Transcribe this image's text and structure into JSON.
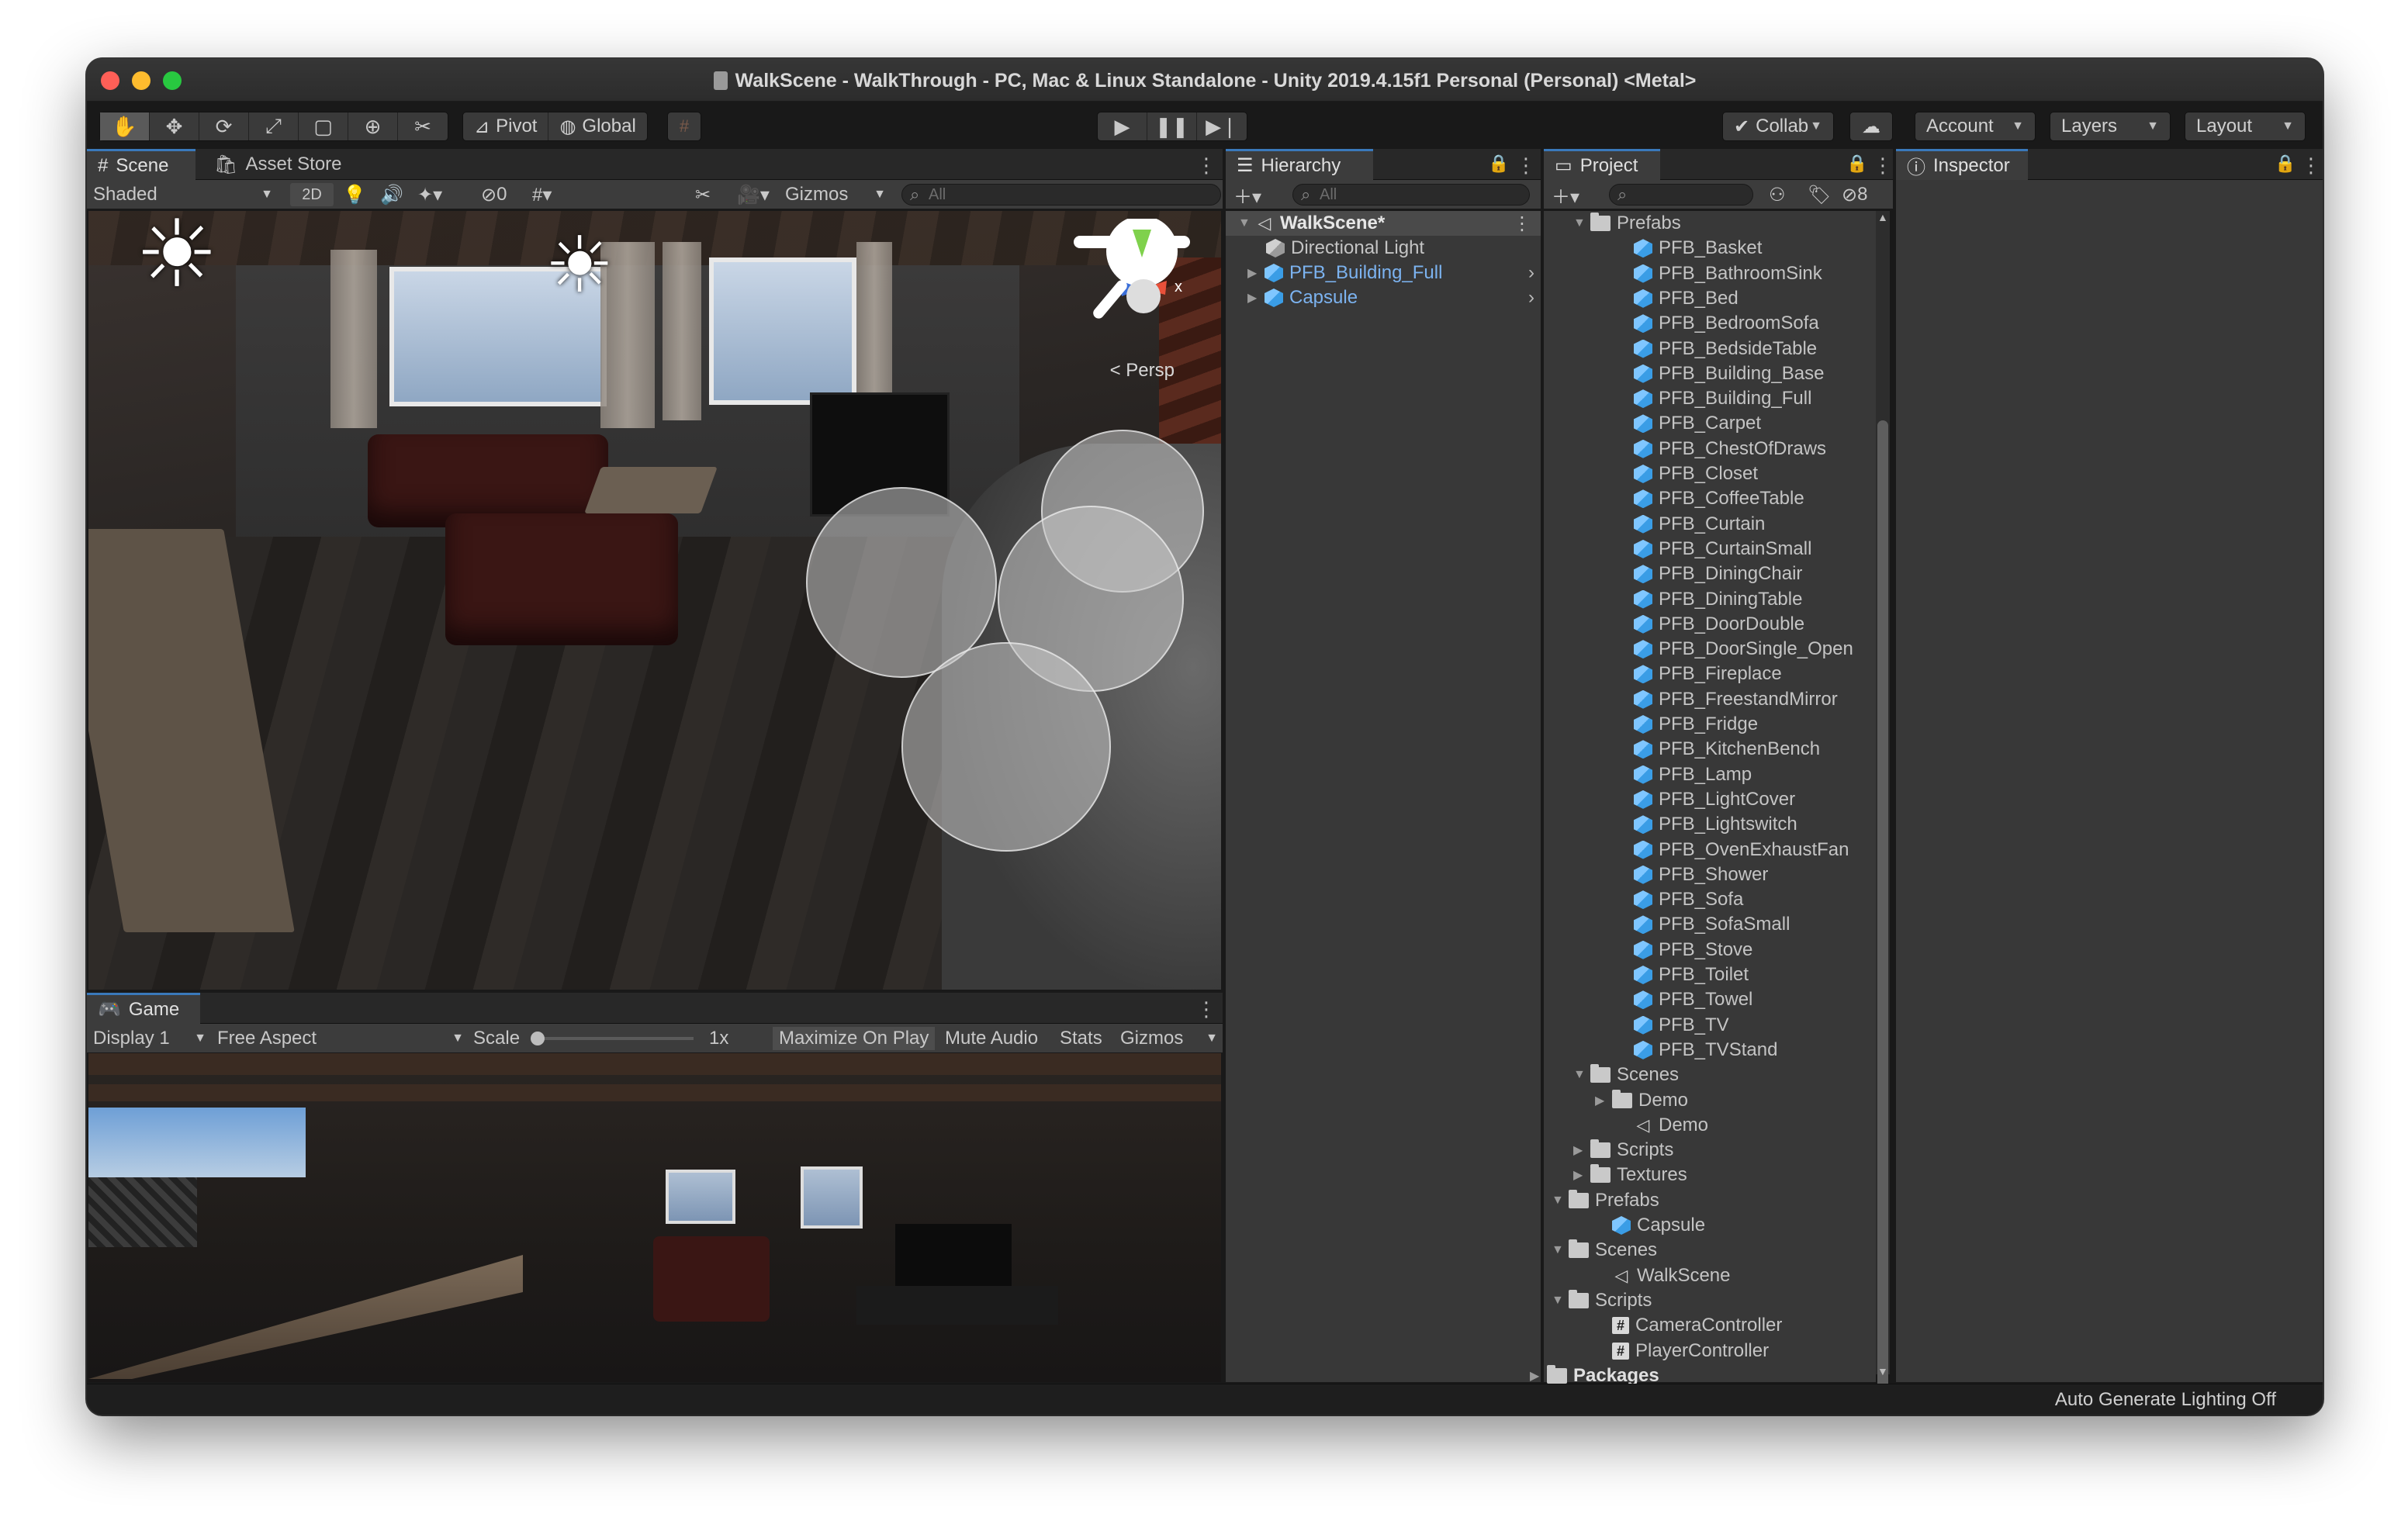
{
  "window": {
    "title": "WalkScene - WalkThrough - PC, Mac & Linux Standalone - Unity 2019.4.15f1 Personal (Personal) <Metal>"
  },
  "toolbar": {
    "tools": [
      "hand-tool",
      "move-tool",
      "rotate-tool",
      "scale-tool",
      "rect-tool",
      "transform-tool",
      "custom-tool"
    ],
    "pivot_label": "Pivot",
    "global_label": "Global",
    "play_controls": [
      "play",
      "pause",
      "step"
    ],
    "collab_label": "Collab",
    "account_label": "Account",
    "layers_label": "Layers",
    "layout_label": "Layout"
  },
  "scene_panel": {
    "tabs": [
      "Scene",
      "Asset Store"
    ],
    "shading_mode": "Shaded",
    "mode_2d": "2D",
    "hidden_count": "0",
    "gizmos_label": "Gizmos",
    "search_placeholder": "All",
    "persp_label": "Persp"
  },
  "game_panel": {
    "tab": "Game",
    "display": "Display 1",
    "aspect": "Free Aspect",
    "scale_label": "Scale",
    "scale_value": "1x",
    "maximize_label": "Maximize On Play",
    "mute_label": "Mute Audio",
    "stats_label": "Stats",
    "gizmos_label": "Gizmos"
  },
  "hierarchy": {
    "tab": "Hierarchy",
    "search_placeholder": "All",
    "scene": "WalkScene*",
    "items": [
      "Directional Light",
      "PFB_Building_Full",
      "Capsule"
    ]
  },
  "project": {
    "tab": "Project",
    "hidden_count": "8",
    "prefab_folder": "Prefabs",
    "prefabs": [
      "PFB_Basket",
      "PFB_BathroomSink",
      "PFB_Bed",
      "PFB_BedroomSofa",
      "PFB_BedsideTable",
      "PFB_Building_Base",
      "PFB_Building_Full",
      "PFB_Carpet",
      "PFB_ChestOfDraws",
      "PFB_Closet",
      "PFB_CoffeeTable",
      "PFB_Curtain",
      "PFB_CurtainSmall",
      "PFB_DiningChair",
      "PFB_DiningTable",
      "PFB_DoorDouble",
      "PFB_DoorSingle_Open",
      "PFB_Fireplace",
      "PFB_FreestandMirror",
      "PFB_Fridge",
      "PFB_KitchenBench",
      "PFB_Lamp",
      "PFB_LightCover",
      "PFB_Lightswitch",
      "PFB_OvenExhaustFan",
      "PFB_Shower",
      "PFB_Sofa",
      "PFB_SofaSmall",
      "PFB_Stove",
      "PFB_Toilet",
      "PFB_Towel",
      "PFB_TV",
      "PFB_TVStand"
    ],
    "sub_scenes_folder": "Scenes",
    "demo_folder": "Demo",
    "demo_scene": "Demo",
    "sub_scripts_folder": "Scripts",
    "textures_folder": "Textures",
    "root_prefabs_folder": "Prefabs",
    "capsule": "Capsule",
    "root_scenes_folder": "Scenes",
    "walkscene": "WalkScene",
    "root_scripts_folder": "Scripts",
    "scripts": [
      "CameraController",
      "PlayerController"
    ],
    "packages": "Packages"
  },
  "inspector": {
    "tab": "Inspector"
  },
  "status_bar": {
    "text": "Auto Generate Lighting Off"
  },
  "colors": {
    "accent": "#3a79bb",
    "prefab_blue": "#7cb3f0",
    "selected_row": "#2c5d87"
  }
}
